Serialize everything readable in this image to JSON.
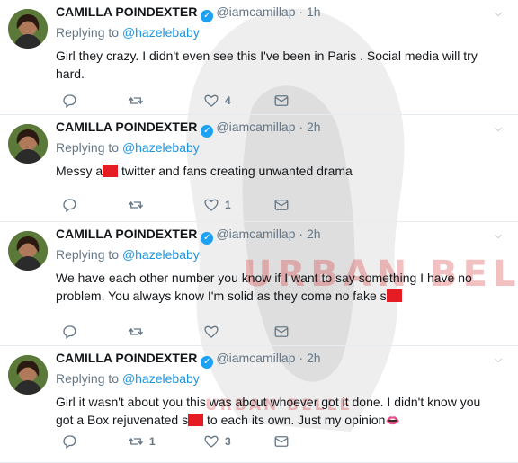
{
  "colors": {
    "link": "#1b95e0",
    "verified": "#1da1f2",
    "redaction": "#e51c23",
    "watermark": "#d73c3c"
  },
  "watermark": {
    "main": "URBAN BELLE",
    "small": "URBAN BELLE"
  },
  "tweets": [
    {
      "name": "CAMILLA POINDEXTER",
      "handle": "@iamcamillap",
      "separator": "·",
      "time": "1h",
      "reply_prefix": "Replying to",
      "reply_to": "@hazelebaby",
      "text_a": "Girl they crazy. I didn't even see this I've been in Paris . Social media will try hard.",
      "text_b": "",
      "text_c": "",
      "retweets": "",
      "likes": "4",
      "icons": [
        "reply-icon",
        "retweet-icon",
        "heart-icon",
        "message-icon"
      ]
    },
    {
      "name": "CAMILLA POINDEXTER",
      "handle": "@iamcamillap",
      "separator": "·",
      "time": "2h",
      "reply_prefix": "Replying to",
      "reply_to": "@hazelebaby",
      "text_a": "Messy a",
      "text_b": " twitter and fans creating unwanted drama",
      "text_c": "",
      "retweets": "",
      "likes": "1",
      "icons": [
        "reply-icon",
        "retweet-icon",
        "heart-icon",
        "message-icon"
      ]
    },
    {
      "name": "CAMILLA POINDEXTER",
      "handle": "@iamcamillap",
      "separator": "·",
      "time": "2h",
      "reply_prefix": "Replying to",
      "reply_to": "@hazelebaby",
      "text_a": "We have each other number you know if I want to say something I have no problem. You always know I'm solid as they come no fake s",
      "text_b": "",
      "text_c": "",
      "retweets": "",
      "likes": "",
      "icons": [
        "reply-icon",
        "retweet-icon",
        "heart-icon",
        "message-icon"
      ]
    },
    {
      "name": "CAMILLA POINDEXTER",
      "handle": "@iamcamillap",
      "separator": "·",
      "time": "2h",
      "reply_prefix": "Replying to",
      "reply_to": "@hazelebaby",
      "text_a": "Girl it wasn't about you this was about whoever got it done. I didn't know you got a Box rejuvenated s",
      "text_b": " to each its own. Just my opinion",
      "text_c": "",
      "retweets": "1",
      "likes": "3",
      "icons": [
        "reply-icon",
        "retweet-icon",
        "heart-icon",
        "message-icon",
        "kiss-lips-icon"
      ]
    }
  ]
}
